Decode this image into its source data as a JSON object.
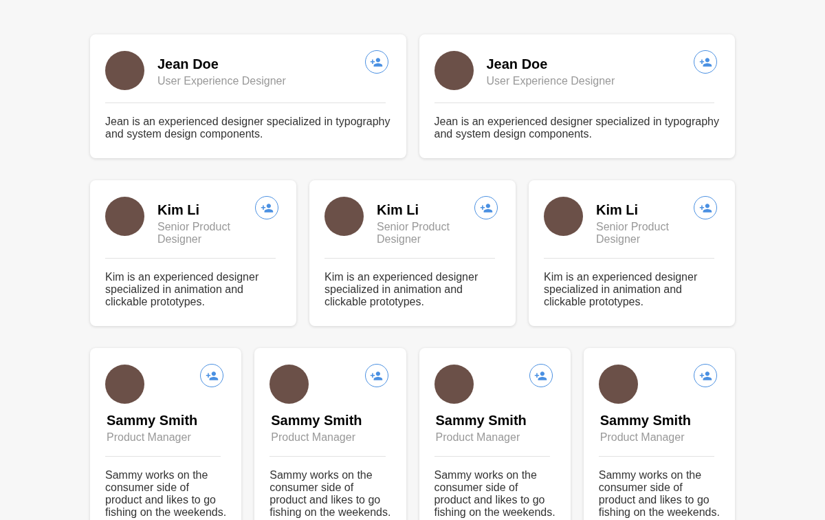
{
  "rows": [
    {
      "kind": "horizontal",
      "cards": [
        {
          "name": "Jean Doe",
          "title": "User Experience Designer",
          "bio": "Jean is an experienced designer specialized in typography and system design components."
        },
        {
          "name": "Jean Doe",
          "title": "User Experience Designer",
          "bio": "Jean is an experienced designer specialized in typography and system design components."
        }
      ]
    },
    {
      "kind": "horizontal",
      "cards": [
        {
          "name": "Kim Li",
          "title": "Senior Product Designer",
          "bio": "Kim is an experienced designer specialized in animation and clickable prototypes."
        },
        {
          "name": "Kim Li",
          "title": "Senior Product Designer",
          "bio": "Kim is an experienced designer specialized in animation and clickable prototypes."
        },
        {
          "name": "Kim Li",
          "title": "Senior Product Designer",
          "bio": "Kim is an experienced designer specialized in animation and clickable prototypes."
        }
      ]
    },
    {
      "kind": "stacked",
      "cards": [
        {
          "name": "Sammy Smith",
          "title": "Product Manager",
          "bio": "Sammy works on the consumer side of product and likes to go fishing on the weekends."
        },
        {
          "name": "Sammy Smith",
          "title": "Product Manager",
          "bio": "Sammy works on the consumer side of product and likes to go fishing on the weekends."
        },
        {
          "name": "Sammy Smith",
          "title": "Product Manager",
          "bio": "Sammy works on the consumer side of product and likes to go fishing on the weekends."
        },
        {
          "name": "Sammy Smith",
          "title": "Product Manager",
          "bio": "Sammy works on the consumer side of product and likes to go fishing on the weekends."
        }
      ]
    }
  ]
}
